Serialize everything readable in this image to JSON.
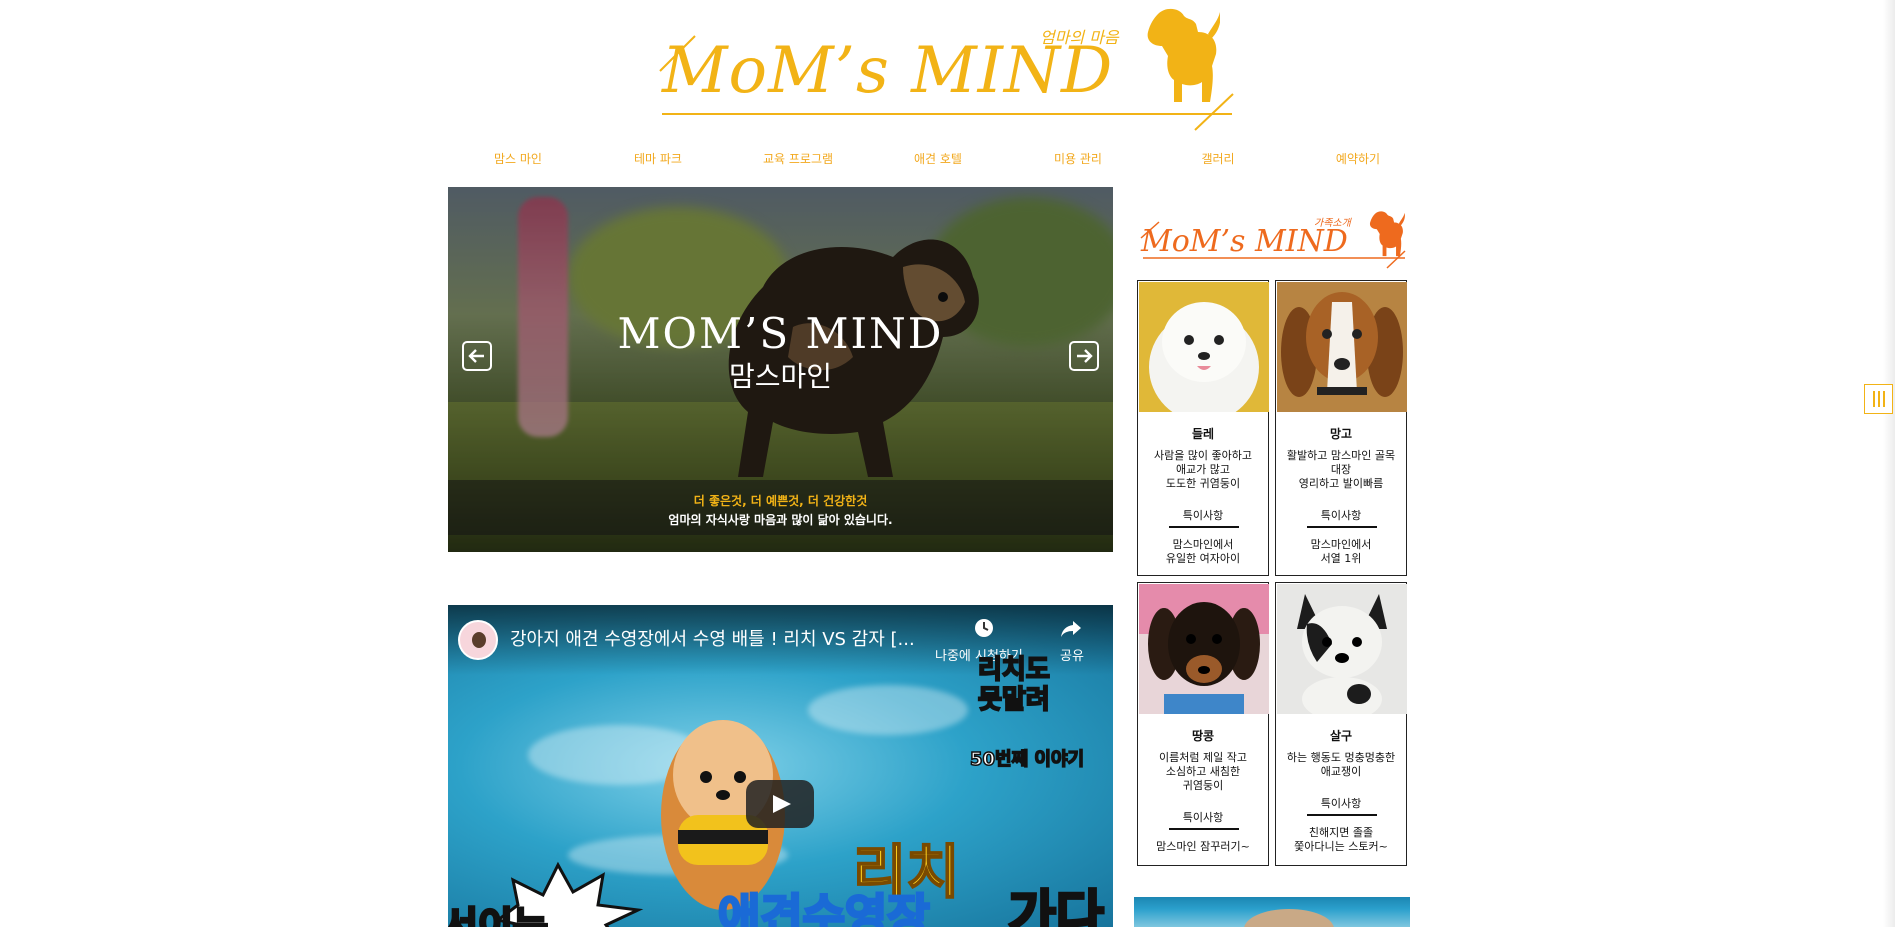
{
  "brand": {
    "logo_text": "MoM’s MIND",
    "logo_sub": "엄마의 마음",
    "primary_color": "#f2b316",
    "accent_color": "#ee6a1e"
  },
  "nav": {
    "items": [
      {
        "label": "맘스 마인"
      },
      {
        "label": "테마 파크"
      },
      {
        "label": "교육 프로그램"
      },
      {
        "label": "애견 호텔"
      },
      {
        "label": "미용 관리"
      },
      {
        "label": "갤러리"
      },
      {
        "label": "예약하기"
      }
    ]
  },
  "hero": {
    "title": "MOM’S MIND",
    "subtitle": "맘스마인",
    "caption_line1": "더 좋은것, 더 예쁜것, 더 건강한것",
    "caption_line2": "엄마의 자식사랑 마음과 많이 닮아 있습니다.",
    "prev_icon": "arrow-left-icon",
    "next_icon": "arrow-right-icon"
  },
  "video": {
    "title": "강아지 애견 수영장에서 수영 배틀 ! 리치 VS 감자 [...",
    "watch_later_label": "나중에 시청하기",
    "share_label": "공유",
    "sticker_text": "리치도\n못말려",
    "sticker_sub": "50번째 이야기",
    "overlay_word1": "리치",
    "overlay_word2": "애견수영장",
    "overlay_word3": "가다",
    "overlay_word4": "서이는"
  },
  "family": {
    "logo_text": "MoM’s MIND",
    "logo_sub": "가족소개",
    "feature_label": "특이사항",
    "members": [
      {
        "name": "들레",
        "desc": "사람을 많이 좋아하고\n애교가 많고\n도도한 귀염둥이",
        "note": "맘스마인에서\n유일한 여자아이"
      },
      {
        "name": "망고",
        "desc": "활발하고 맘스마인 골목\n대장\n영리하고 발이빠름",
        "note": "맘스마인에서\n서열 1위"
      },
      {
        "name": "땅콩",
        "desc": "이름처럼 제일 작고\n소심하고 새침한\n귀염둥이",
        "note": "맘스마인 잠꾸러기~"
      },
      {
        "name": "살구",
        "desc": "하는 행동도 멍충멍충한\n애교쟁이",
        "note": "친해지면 졸졸\n쫓아다니는 스토커~"
      }
    ]
  }
}
